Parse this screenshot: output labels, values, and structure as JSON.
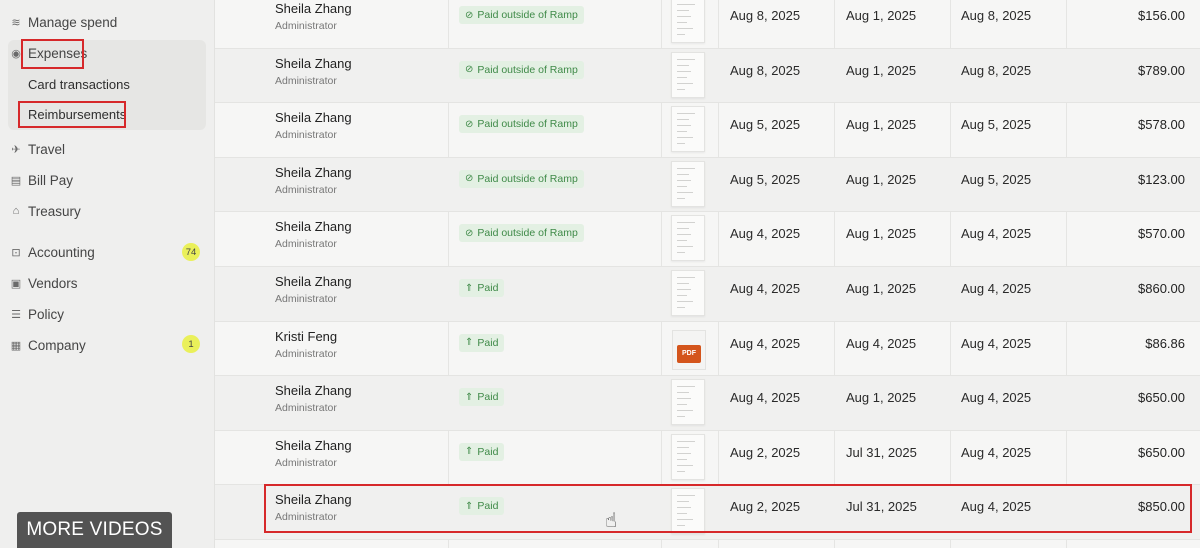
{
  "sidebar": {
    "manage_spend": "Manage spend",
    "expenses": "Expenses",
    "card_transactions": "Card transactions",
    "reimbursements": "Reimbursements",
    "travel": "Travel",
    "bill_pay": "Bill Pay",
    "treasury": "Treasury",
    "accounting": "Accounting",
    "accounting_badge": "74",
    "vendors": "Vendors",
    "policy": "Policy",
    "company": "Company",
    "company_badge": "1"
  },
  "overlay": {
    "more_videos": "MORE VIDEOS"
  },
  "rows": [
    {
      "name": "Sheila Zhang",
      "role": "Administrator",
      "status": "Paid outside of Ramp",
      "receipt": "doc",
      "d1": "Aug 8, 2025",
      "d2": "Aug 1, 2025",
      "d3": "Aug 8, 2025",
      "amount": "$156.00"
    },
    {
      "name": "Sheila Zhang",
      "role": "Administrator",
      "status": "Paid outside of Ramp",
      "receipt": "doc",
      "d1": "Aug 8, 2025",
      "d2": "Aug 1, 2025",
      "d3": "Aug 8, 2025",
      "amount": "$789.00"
    },
    {
      "name": "Sheila Zhang",
      "role": "Administrator",
      "status": "Paid outside of Ramp",
      "receipt": "doc",
      "d1": "Aug 5, 2025",
      "d2": "Aug 1, 2025",
      "d3": "Aug 5, 2025",
      "amount": "$578.00"
    },
    {
      "name": "Sheila Zhang",
      "role": "Administrator",
      "status": "Paid outside of Ramp",
      "receipt": "doc",
      "d1": "Aug 5, 2025",
      "d2": "Aug 1, 2025",
      "d3": "Aug 5, 2025",
      "amount": "$123.00"
    },
    {
      "name": "Sheila Zhang",
      "role": "Administrator",
      "status": "Paid outside of Ramp",
      "receipt": "doc",
      "d1": "Aug 4, 2025",
      "d2": "Aug 1, 2025",
      "d3": "Aug 4, 2025",
      "amount": "$570.00"
    },
    {
      "name": "Sheila Zhang",
      "role": "Administrator",
      "status": "Paid",
      "receipt": "doc",
      "d1": "Aug 4, 2025",
      "d2": "Aug 1, 2025",
      "d3": "Aug 4, 2025",
      "amount": "$860.00"
    },
    {
      "name": "Kristi Feng",
      "role": "Administrator",
      "status": "Paid",
      "receipt": "pdf",
      "receipt_label": "PDF",
      "d1": "Aug 4, 2025",
      "d2": "Aug 4, 2025",
      "d3": "Aug 4, 2025",
      "amount": "$86.86"
    },
    {
      "name": "Sheila Zhang",
      "role": "Administrator",
      "status": "Paid",
      "receipt": "doc",
      "d1": "Aug 4, 2025",
      "d2": "Aug 1, 2025",
      "d3": "Aug 4, 2025",
      "amount": "$650.00"
    },
    {
      "name": "Sheila Zhang",
      "role": "Administrator",
      "status": "Paid",
      "receipt": "doc",
      "d1": "Aug 2, 2025",
      "d2": "Jul 31, 2025",
      "d3": "Aug 4, 2025",
      "amount": "$650.00"
    },
    {
      "name": "Sheila Zhang",
      "role": "Administrator",
      "status": "Paid",
      "receipt": "doc",
      "d1": "Aug 2, 2025",
      "d2": "Jul 31, 2025",
      "d3": "Aug 4, 2025",
      "amount": "$850.00"
    }
  ],
  "colors": {
    "highlight": "#d6282a",
    "status_bg": "#e3f0e3",
    "status_text": "#3f8a48",
    "badge": "#eaf05a",
    "pdf": "#d4551c"
  }
}
